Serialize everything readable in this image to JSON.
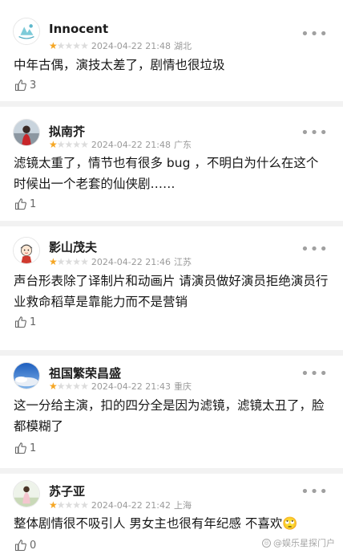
{
  "reviews": [
    {
      "user": "Innocent",
      "rating": 1,
      "time": "2024-04-22 21:48",
      "location": "湖北",
      "text": "中年古偶，演技太差了，剧情也很垃圾",
      "likes": "3",
      "avatar_icon": "logo-avatar-icon"
    },
    {
      "user": "拟南芥",
      "rating": 1,
      "time": "2024-04-22 21:48",
      "location": "广东",
      "text": "滤镜太重了，情节也有很多 bug ，不明白为什么在这个时候出一个老套的仙侠剧……",
      "likes": "1",
      "avatar_icon": "person-avatar-icon"
    },
    {
      "user": "影山茂夫",
      "rating": 1,
      "time": "2024-04-22 21:46",
      "location": "江苏",
      "text": "声台形表除了译制片和动画片 请演员做好演员拒绝演员行业救命稻草是靠能力而不是营销",
      "likes": "1",
      "avatar_icon": "cartoon-avatar-icon"
    },
    {
      "user": "祖国繁荣昌盛",
      "rating": 1,
      "time": "2024-04-22 21:43",
      "location": "重庆",
      "text": "这一分给主演，扣的四分全是因为滤镜，滤镜太丑了，脸都模糊了",
      "likes": "1",
      "avatar_icon": "sky-avatar-icon"
    },
    {
      "user": "苏子亚",
      "rating": 1,
      "time": "2024-04-22 21:42",
      "location": "上海",
      "text": "整体剧情很不吸引人 男女主也很有年纪感 不喜欢",
      "likes": "0",
      "avatar_icon": "photo-avatar-icon"
    }
  ],
  "emoji_last": "🙄",
  "watermark": "@娱乐星探门户",
  "colors": {
    "star_on": "#f5a623",
    "star_off": "#dcdcdc",
    "meta": "#9a9a9a"
  }
}
